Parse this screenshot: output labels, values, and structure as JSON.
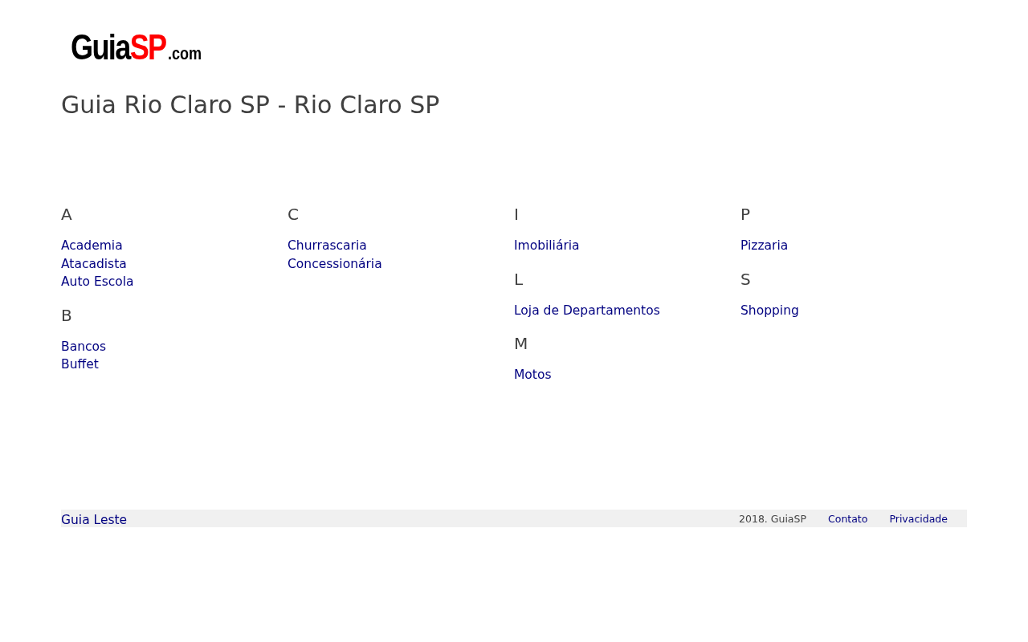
{
  "logo": {
    "parts": [
      {
        "text": "Guia",
        "color": "#000000"
      },
      {
        "text": "SP",
        "color": "#ff0000"
      },
      {
        "text": ".com",
        "color": "#000000"
      }
    ]
  },
  "title": "Guia Rio Claro SP - Rio Claro SP",
  "columns": [
    {
      "groups": [
        {
          "letter": "A",
          "links": [
            "Academia",
            "Atacadista",
            "Auto Escola"
          ]
        },
        {
          "letter": "B",
          "links": [
            "Bancos",
            "Buffet"
          ]
        }
      ]
    },
    {
      "groups": [
        {
          "letter": "C",
          "links": [
            "Churrascaria",
            "Concessionária"
          ]
        }
      ]
    },
    {
      "groups": [
        {
          "letter": "I",
          "links": [
            "Imobiliária"
          ]
        },
        {
          "letter": "L",
          "links": [
            "Loja de Departamentos"
          ]
        },
        {
          "letter": "M",
          "links": [
            "Motos"
          ]
        }
      ]
    },
    {
      "groups": [
        {
          "letter": "P",
          "links": [
            "Pizzaria"
          ]
        },
        {
          "letter": "S",
          "links": [
            "Shopping"
          ]
        }
      ]
    }
  ],
  "footer": {
    "left_link": "Guia Leste",
    "copyright": "2018. GuiaSP",
    "links": [
      "Contato",
      "Privacidade"
    ]
  }
}
